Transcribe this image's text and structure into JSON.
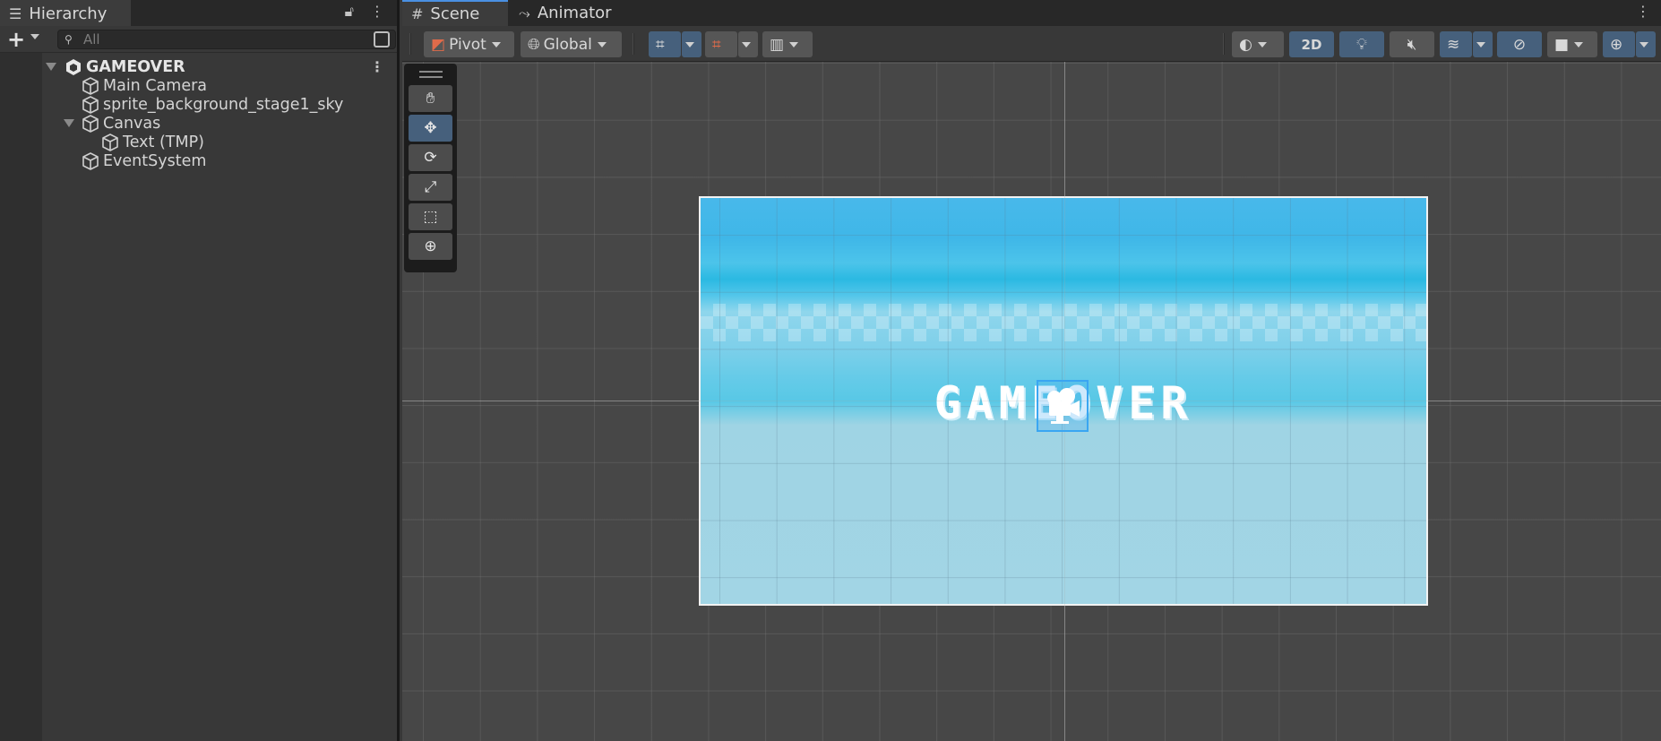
{
  "hierarchy": {
    "tab_label": "Hierarchy",
    "search_placeholder": "All",
    "scene_name": "GAMEOVER",
    "items": [
      {
        "label": "Main Camera"
      },
      {
        "label": "sprite_background_stage1_sky"
      },
      {
        "label": "Canvas"
      },
      {
        "label": "Text (TMP)"
      },
      {
        "label": "EventSystem"
      }
    ]
  },
  "scene": {
    "tabs": [
      {
        "label": "Scene"
      },
      {
        "label": "Animator"
      }
    ],
    "toolbar": {
      "pivot_label": "Pivot",
      "global_label": "Global",
      "mode_2d_label": "2D"
    },
    "game_text": "GAMEOVER",
    "tools": [
      "hand-tool",
      "move-tool",
      "rotate-tool",
      "scale-tool",
      "rect-tool",
      "transform-tool"
    ],
    "active_tool": "move-tool"
  },
  "colors": {
    "accent": "#46607c",
    "selection": "#3aa6f2",
    "sky_top": "#48b8ea",
    "sky_bottom": "#a2d5e5"
  }
}
